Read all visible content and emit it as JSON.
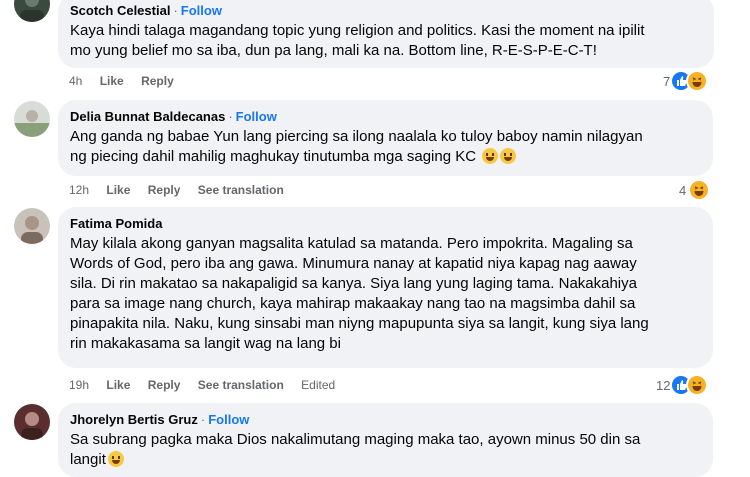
{
  "follow_label": "Follow",
  "comments": [
    {
      "name": "Scotch Celestial",
      "show_follow": true,
      "lines": [
        "Kaya hindi talaga magandang topic yung religion and politics. Kasi the moment na ipilit",
        "mo yung belief mo sa iba, dun pa lang, mali ka na. Bottom line, R-E-S-P-E-C-T!"
      ],
      "time": "4h",
      "like": "Like",
      "reply": "Reply",
      "reaction_count": "7",
      "reactions": [
        "like",
        "haha"
      ]
    },
    {
      "name": "Delia Bunnat Baldecanas",
      "show_follow": true,
      "lines": [
        "Ang ganda ng babae Yun lang piercing sa ilong naalala ko tuloy baboy namin nilagyan",
        "ng piecing dahil mahilig maghukay tinutumba mga saging KC"
      ],
      "emoji_count": 2,
      "time": "12h",
      "like": "Like",
      "reply": "Reply",
      "translate": "See translation",
      "reaction_count": "4",
      "reactions": [
        "haha"
      ]
    },
    {
      "name": "Fatima Pomida",
      "show_follow": false,
      "lines": [
        "May kilala akong ganyan magsalita katulad sa matanda. Pero impokrita. Magaling sa",
        "Words of God, pero iba ang gawa. Minumura nanay at kapatid niya kapag nag aaway",
        "sila. Di rin makatao sa nakapaligid sa kanya. Siya lang yung laging tama. Nakakahiya",
        "para sa image nang church, kaya mahirap makaakay nang tao na magsimba dahil sa",
        "pinapakita nila. Naku, kung sinsabi man niyng mapupunta siya sa langit, kung siya lang",
        "rin makakasama sa langit wag na lang bi"
      ],
      "time": "19h",
      "like": "Like",
      "reply": "Reply",
      "translate": "See translation",
      "edited": "Edited",
      "reaction_count": "12",
      "reactions": [
        "like",
        "haha"
      ]
    },
    {
      "name": "Jhorelyn Bertis Gruz",
      "show_follow": true,
      "lines": [
        "Sa subrang pagka maka Dios nakalimutang maging maka tao, ayown minus 50 din sa",
        "langit"
      ],
      "emoji_count": 1,
      "reactions": []
    }
  ],
  "colors": {
    "bubble": "#f0f2f5",
    "follow": "#1877f2",
    "meta": "#65676b",
    "like": "#1877f2",
    "haha": "#f7b125"
  }
}
